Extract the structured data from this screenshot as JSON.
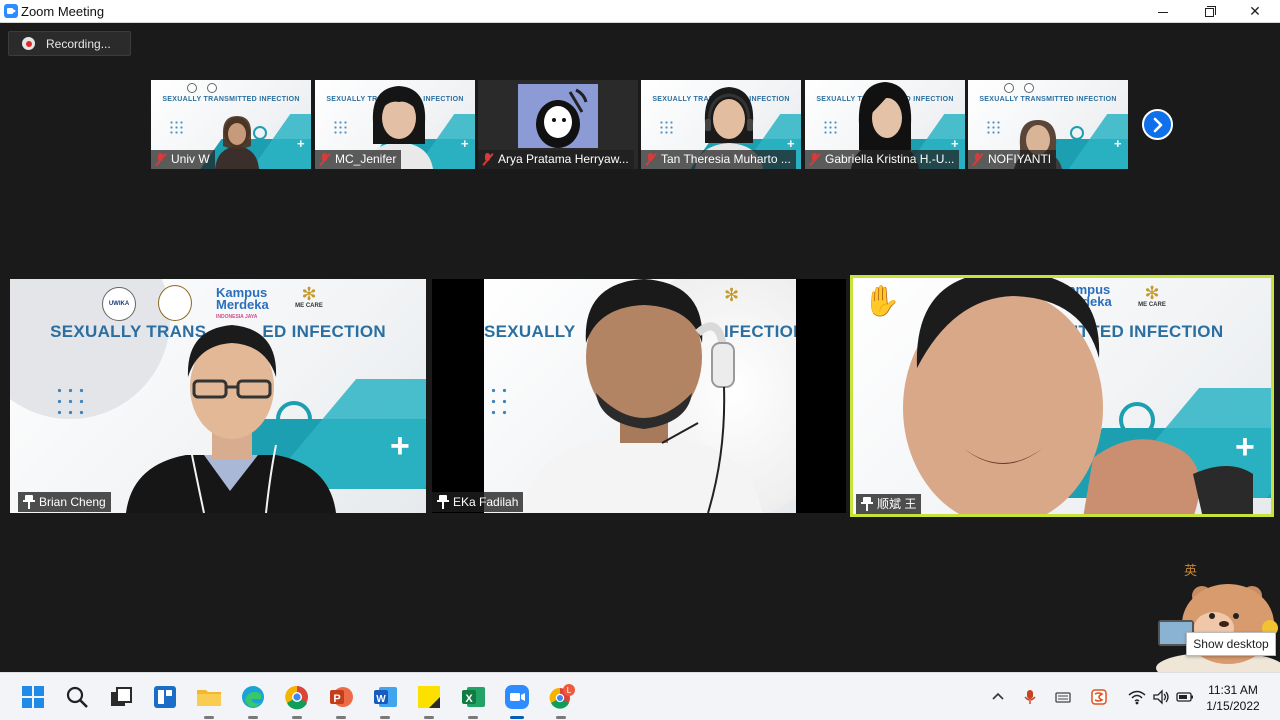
{
  "window": {
    "title": "Zoom Meeting",
    "minimize_glyph": "",
    "maximize_glyph": "",
    "close_glyph": "✕"
  },
  "recording": {
    "label": "Recording..."
  },
  "slide": {
    "title_full": "SEXUALLY TRANSMITTED INFECTION",
    "title_partial_left": "SEXUALLY TRANS",
    "title_partial_middle": "ED INFECTION",
    "title_partial_right": "MITTED INFECTION",
    "title_partial_ekfa": "IFECTION",
    "kampus_line1": "Kampus",
    "kampus_line2": "Merdeka",
    "kampus_tag": "INDONESIA JAYA",
    "mecare": "ME CARE",
    "uwika": "UWIKA",
    "accent_color": "#1c9fb0"
  },
  "thumbnails": [
    {
      "name": "Univ W",
      "muted": true
    },
    {
      "name": "MC_Jenifer",
      "muted": true
    },
    {
      "name": "Arya Pratama Herryaw...",
      "muted": true
    },
    {
      "name": "Tan Theresia Muharto ...",
      "muted": true
    },
    {
      "name": "Gabriella Kristina H.-U...",
      "muted": true
    },
    {
      "name": "NOFIYANTI",
      "muted": true
    }
  ],
  "next_page_icon": "chevron-right-icon",
  "tiles": [
    {
      "name": "Brian Cheng",
      "pinned": true,
      "raised_hand": false
    },
    {
      "name": "EKa Fadilah",
      "pinned": true,
      "raised_hand": false
    },
    {
      "name": "顺斌 王",
      "pinned": true,
      "raised_hand": true,
      "raise_hand_glyph": "✋",
      "border_color": "#c7e23a"
    }
  ],
  "desktop_widget": {
    "tooltip": "Show desktop",
    "badge_text": "英"
  },
  "taskbar": {
    "apps": [
      "windows-start",
      "search",
      "task-view",
      "widgets",
      "file-explorer",
      "edge",
      "chrome",
      "powerpoint",
      "word",
      "sticky-notes",
      "excel",
      "zoom",
      "chrome-profile"
    ],
    "tray": {
      "chevron": "^",
      "ime": "拼"
    },
    "clock": {
      "time": "11:31 AM",
      "date": "1/15/2022"
    }
  }
}
